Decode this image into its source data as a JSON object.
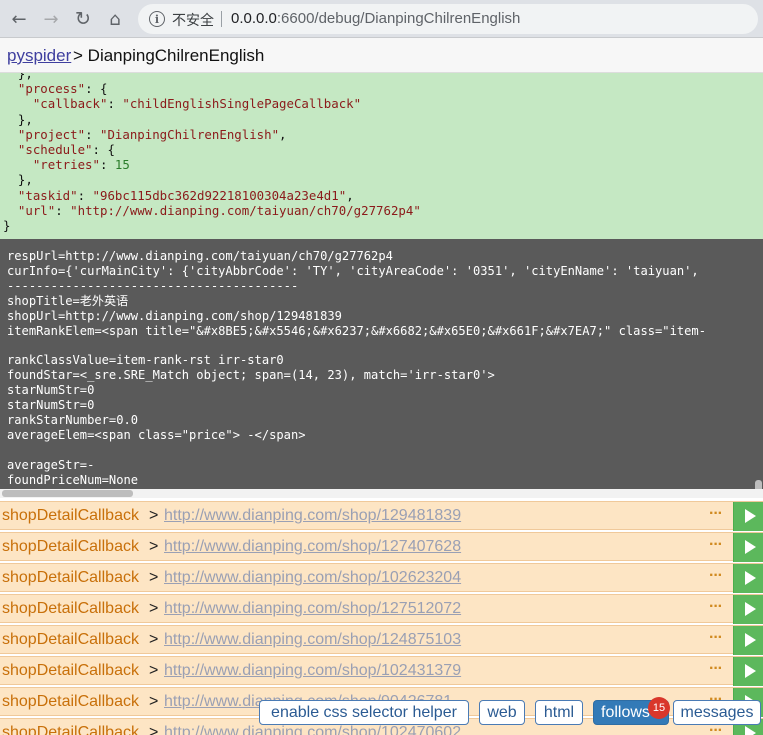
{
  "browser": {
    "insecure_label": "不安全",
    "url_host": "0.0.0.0",
    "url_rest": ":6600/debug/DianpingChilrenEnglish"
  },
  "header": {
    "brand": "pyspider",
    "separator": ">",
    "project": "DianpingChilrenEnglish"
  },
  "task_json": {
    "lines": [
      "  },",
      "  \"process\": {",
      "    \"callback\": \"childEnglishSinglePageCallback\"",
      "  },",
      "  \"project\": \"DianpingChilrenEnglish\",",
      "  \"schedule\": {",
      "    \"retries\": 15",
      "  },",
      "  \"taskid\": \"96bc115dbc362d92218100304a23e4d1\",",
      "  \"url\": \"http://www.dianping.com/taiyuan/ch70/g27762p4\"",
      "}"
    ],
    "pager": {
      "prev": "<",
      "sep": "|",
      "next": ">"
    }
  },
  "console": {
    "lines": [
      "respUrl=http://www.dianping.com/taiyuan/ch70/g27762p4",
      "curInfo={'curMainCity': {'cityAbbrCode': 'TY', 'cityAreaCode': '0351', 'cityEnName': 'taiyuan',",
      "----------------------------------------",
      "shopTitle=老外英语",
      "shopUrl=http://www.dianping.com/shop/129481839",
      "itemRankElem=<span title=\"&#x8BE5;&#x5546;&#x6237;&#x6682;&#x65E0;&#x661F;&#x7EA7;\" class=\"item-",
      "",
      "rankClassValue=item-rank-rst irr-star0",
      "foundStar=<_sre.SRE_Match object; span=(14, 23), match='irr-star0'>",
      "starNumStr=0",
      "starNumStr=0",
      "rankStarNumber=0.0",
      "averageElem=<span class=\"price\"> -</span>",
      "",
      "averageStr=-",
      "foundPriceNum=None"
    ]
  },
  "follows": {
    "rows": [
      {
        "callback": "shopDetailCallback",
        "sep": ">",
        "url": "http://www.dianping.com/shop/129481839",
        "dots": "···"
      },
      {
        "callback": "shopDetailCallback",
        "sep": ">",
        "url": "http://www.dianping.com/shop/127407628",
        "dots": "···"
      },
      {
        "callback": "shopDetailCallback",
        "sep": ">",
        "url": "http://www.dianping.com/shop/102623204",
        "dots": "···"
      },
      {
        "callback": "shopDetailCallback",
        "sep": ">",
        "url": "http://www.dianping.com/shop/127512072",
        "dots": "···"
      },
      {
        "callback": "shopDetailCallback",
        "sep": ">",
        "url": "http://www.dianping.com/shop/124875103",
        "dots": "···"
      },
      {
        "callback": "shopDetailCallback",
        "sep": ">",
        "url": "http://www.dianping.com/shop/102431379",
        "dots": "···"
      },
      {
        "callback": "shopDetailCallback",
        "sep": ">",
        "url": "http://www.dianping.com/shop/90426781",
        "dots": "···"
      },
      {
        "callback": "shopDetailCallback",
        "sep": ">",
        "url": "http://www.dianping.com/shop/102470602",
        "dots": "···"
      }
    ]
  },
  "toolbar": {
    "css_helper_label": "enable css selector helper",
    "web_label": "web",
    "html_label": "html",
    "follows_label": "follows",
    "follows_count": "15",
    "messages_label": "messages"
  },
  "colors": {
    "task_bg": "#c5e8c3",
    "console_bg": "#5a5a5a",
    "follow_row_bg": "#fde5c4",
    "run_btn": "#5cb85c",
    "active_tab": "#337ab7"
  },
  "icons": {
    "back": "arrow-left-icon",
    "forward": "arrow-right-icon",
    "reload": "reload-icon",
    "home": "home-icon",
    "info": "info-icon",
    "run": "play-icon"
  }
}
